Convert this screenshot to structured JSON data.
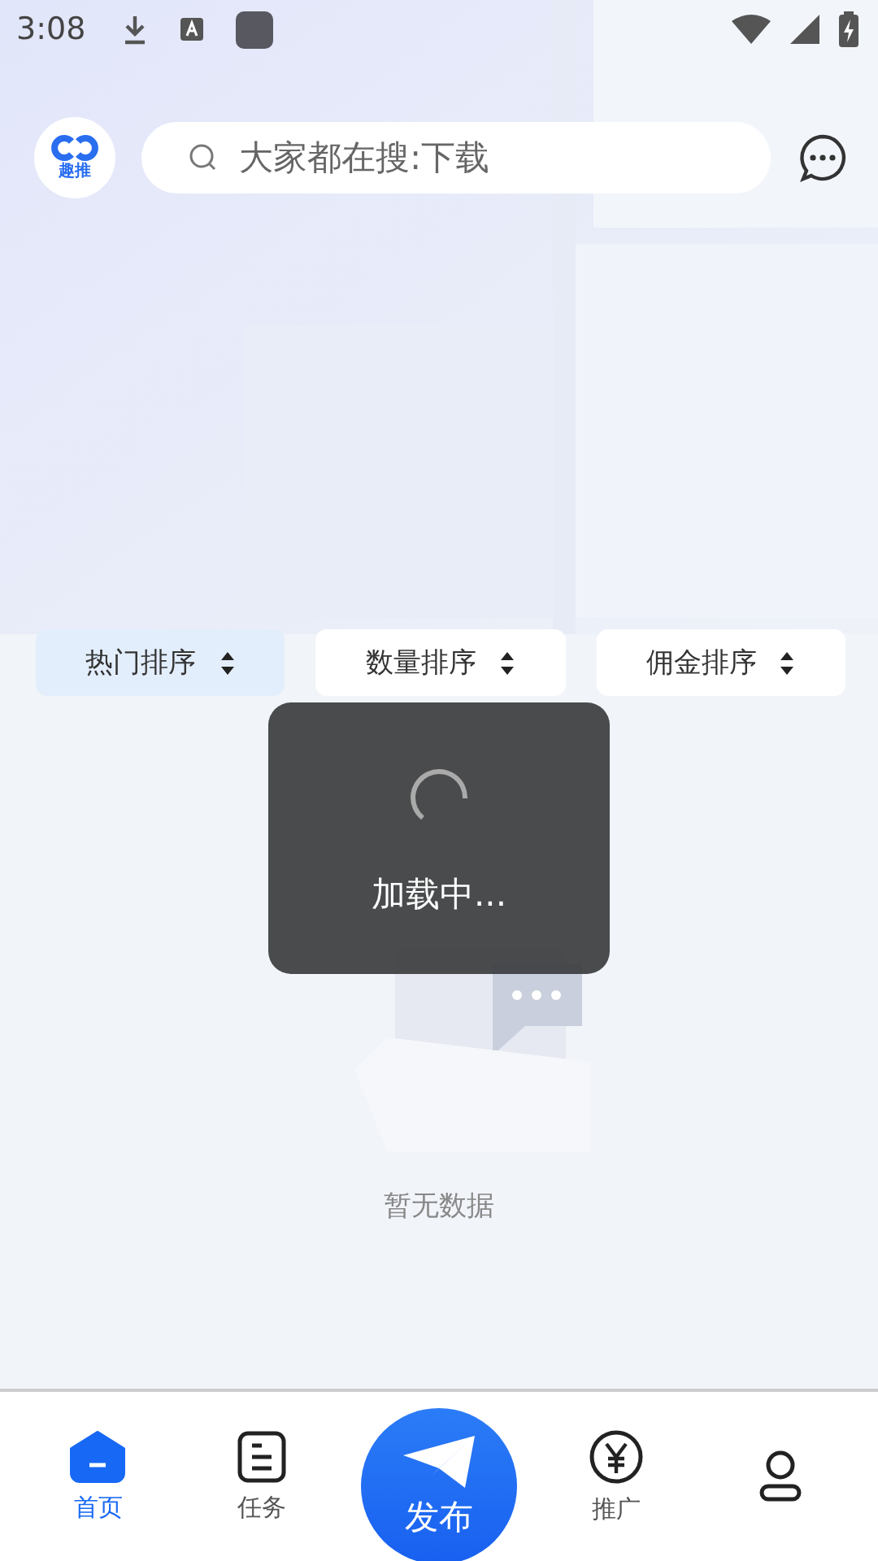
{
  "status_bar": {
    "time": "3:08"
  },
  "header": {
    "logo_text": "趣推",
    "search": {
      "placeholder": "大家都在搜:下载"
    }
  },
  "sort_options": [
    {
      "label": "热门排序",
      "selected": true
    },
    {
      "label": "数量排序",
      "selected": false
    },
    {
      "label": "佣金排序",
      "selected": false
    }
  ],
  "empty_state": {
    "message": "暂无数据"
  },
  "loading_toast": {
    "message": "加载中..."
  },
  "bottom_nav": [
    {
      "kind": "home",
      "label": "首页",
      "selected": true
    },
    {
      "kind": "task",
      "label": "任务",
      "selected": false
    },
    {
      "kind": "publish",
      "label": "发布",
      "selected": false
    },
    {
      "kind": "promote",
      "label": "推广",
      "selected": false
    },
    {
      "kind": "profile",
      "selected": false
    }
  ]
}
